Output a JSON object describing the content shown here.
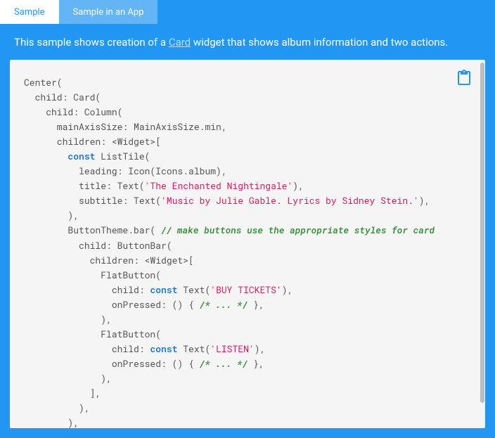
{
  "tabs": [
    {
      "label": "Sample",
      "active": true
    },
    {
      "label": "Sample in an App",
      "active": false
    }
  ],
  "description": {
    "pre": "This sample shows creation of a ",
    "link": "Card",
    "post": " widget that shows album information and two actions."
  },
  "copy_label": "copy",
  "code": {
    "l1": "Center(",
    "l2": "  child: Card(",
    "l3": "    child: Column(",
    "l4": "      mainAxisSize: MainAxisSize.min,",
    "l5": "      children: <Widget>[",
    "l6a": "        ",
    "l6kw": "const",
    "l6b": " ListTile(",
    "l7": "          leading: Icon(Icons.album),",
    "l8a": "          title: Text(",
    "l8s": "'The Enchanted Nightingale'",
    "l8b": "),",
    "l9a": "          subtitle: Text(",
    "l9s": "'Music by Julie Gable. Lyrics by Sidney Stein.'",
    "l9b": "),",
    "l10": "        ),",
    "l11a": "        ButtonTheme.bar( ",
    "l11c": "// make buttons use the appropriate styles for card",
    "l12": "          child: ButtonBar(",
    "l13": "            children: <Widget>[",
    "l14": "              FlatButton(",
    "l15a": "                child: ",
    "l15kw": "const",
    "l15b": " Text(",
    "l15s": "'BUY TICKETS'",
    "l15c": "),",
    "l16a": "                onPressed: () { ",
    "l16c": "/* ... */",
    "l16b": " },",
    "l17": "              ),",
    "l18": "              FlatButton(",
    "l19a": "                child: ",
    "l19kw": "const",
    "l19b": " Text(",
    "l19s": "'LISTEN'",
    "l19c": "),",
    "l20a": "                onPressed: () { ",
    "l20c": "/* ... */",
    "l20b": " },",
    "l21": "              ),",
    "l22": "            ],",
    "l23": "          ),",
    "l24": "        ),"
  }
}
